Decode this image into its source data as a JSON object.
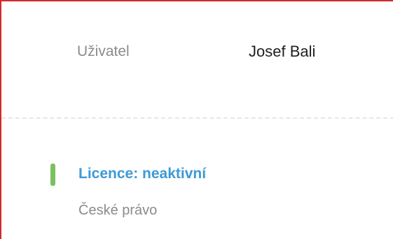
{
  "user": {
    "label": "Uživatel",
    "name": "Josef Bali"
  },
  "license": {
    "title": "Licence: neaktivní",
    "subtitle": "České právo",
    "status_color": "#7cc05d",
    "title_color": "#3c9ad6"
  },
  "frame": {
    "border_color": "#d32a2a"
  }
}
